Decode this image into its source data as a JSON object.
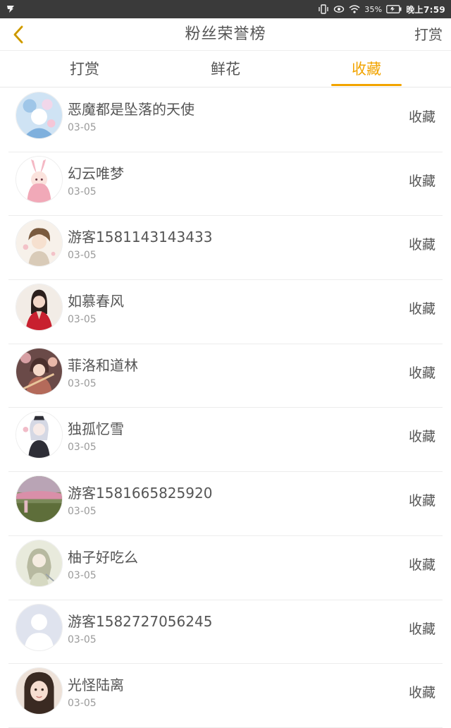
{
  "status_bar": {
    "battery": "35%",
    "time": "晚上7:59"
  },
  "header": {
    "title": "粉丝荣誉榜",
    "right_link": "打赏"
  },
  "tabs": [
    {
      "label": "打赏",
      "active": false
    },
    {
      "label": "鲜花",
      "active": false
    },
    {
      "label": "收藏",
      "active": true
    }
  ],
  "accent_color": "#f2a400",
  "list": [
    {
      "name": "恶魔都是坠落的天使",
      "date": "03-05",
      "action": "收藏"
    },
    {
      "name": "幻云唯梦",
      "date": "03-05",
      "action": "收藏"
    },
    {
      "name": "游客1581143143433",
      "date": "03-05",
      "action": "收藏"
    },
    {
      "name": "如慕春风",
      "date": "03-05",
      "action": "收藏"
    },
    {
      "name": "菲洛和道林",
      "date": "03-05",
      "action": "收藏"
    },
    {
      "name": "独孤忆雪",
      "date": "03-05",
      "action": "收藏"
    },
    {
      "name": "游客1581665825920",
      "date": "03-05",
      "action": "收藏"
    },
    {
      "name": "柚子好吃么",
      "date": "03-05",
      "action": "收藏"
    },
    {
      "name": "游客1582727056245",
      "date": "03-05",
      "action": "收藏"
    },
    {
      "name": "光怪陆离",
      "date": "03-05",
      "action": "收藏"
    }
  ]
}
